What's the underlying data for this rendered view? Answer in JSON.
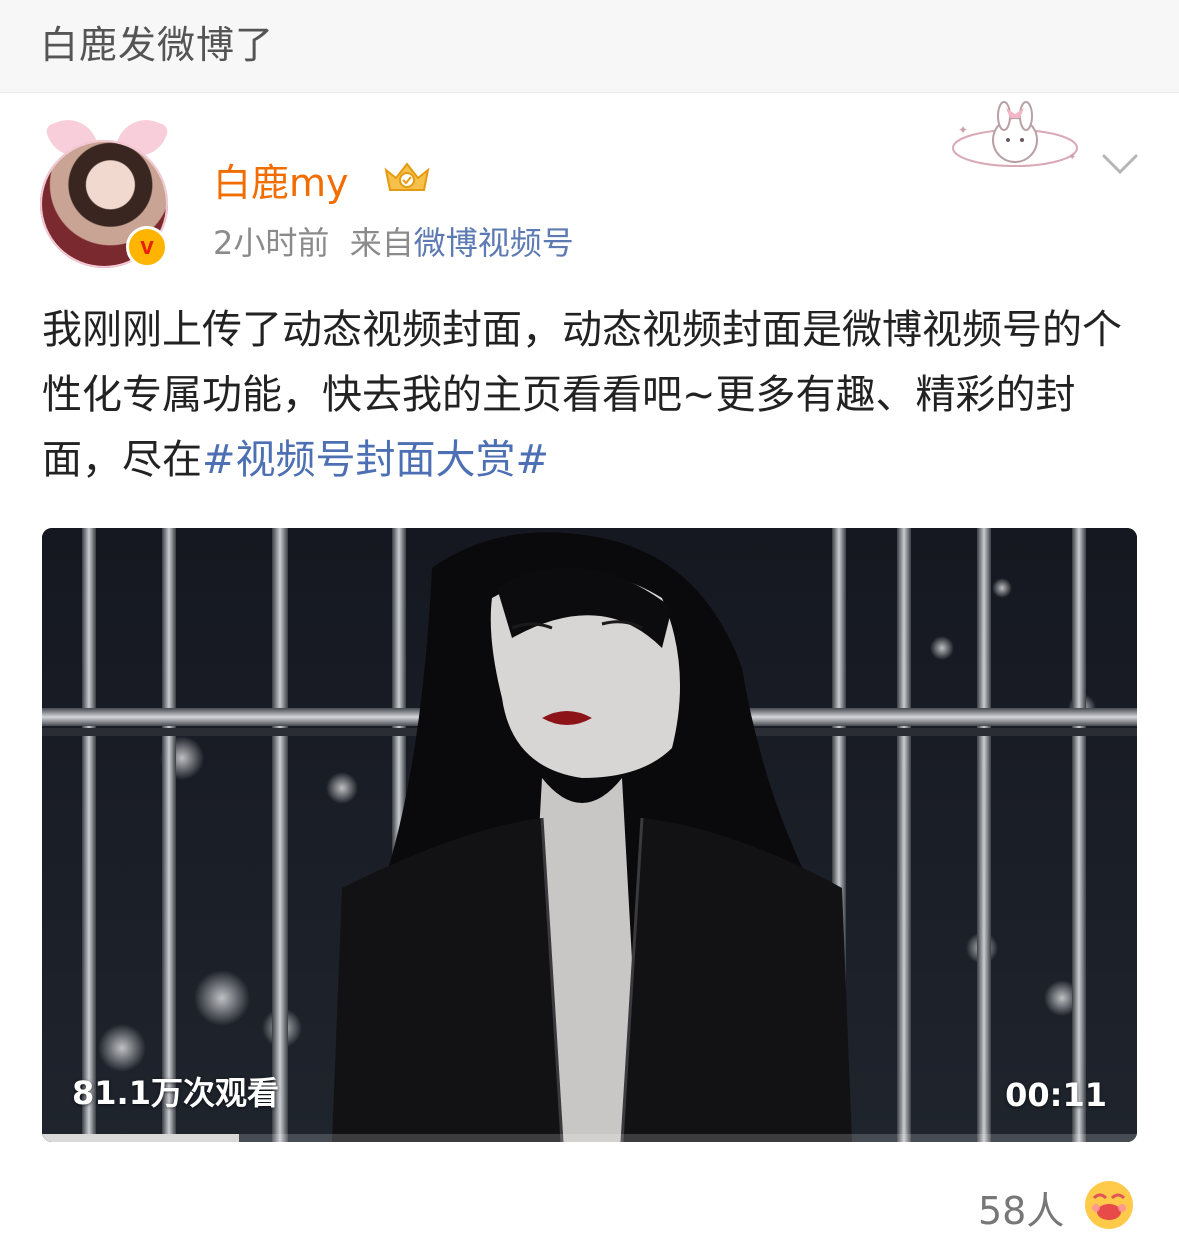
{
  "topbar": {
    "title": "白鹿发微博了"
  },
  "post": {
    "author": "白鹿my",
    "time": "2小时前",
    "source_prefix": "来自",
    "source": "微博视频号",
    "text_main": "我刚刚上传了动态视频封面，动态视频封面是微博视频号的个性化专属功能，快去我的主页看看吧~更多有趣、精彩的封面，尽在",
    "hashtag": "#视频号封面大赏#"
  },
  "video": {
    "views": "81.1万次观看",
    "duration": "00:11",
    "progress": 0.18
  },
  "reactions": {
    "count": "58人"
  },
  "colors": {
    "username": "#f26d00",
    "link": "#4d6fb4",
    "meta": "#8b8b8b",
    "verified": "#ffb400"
  },
  "icons": [
    "verified-badge-icon",
    "crown-member-icon",
    "bunny-sticker-icon",
    "chevron-down-icon",
    "reaction-emoji-icon"
  ]
}
